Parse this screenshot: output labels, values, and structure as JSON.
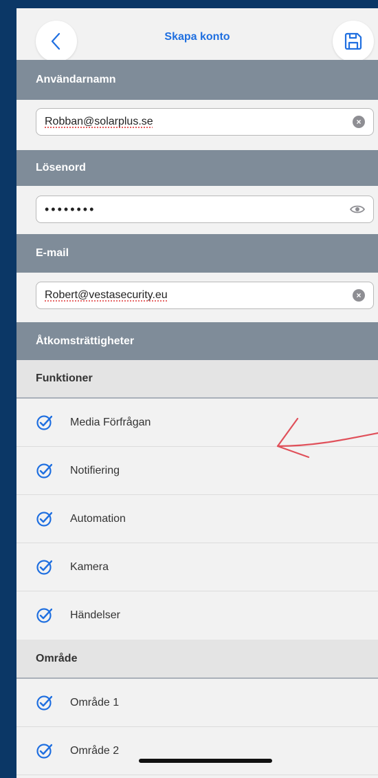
{
  "header": {
    "title": "Skapa konto",
    "back_icon": "chevron-left-icon",
    "save_icon": "floppy-disk-icon",
    "accent": "#1f6fe0"
  },
  "username": {
    "label": "Användarnamn",
    "value": "Robban@solarplus.se"
  },
  "password": {
    "label": "Lösenord",
    "value": "••••••••"
  },
  "email": {
    "label": "E-mail",
    "value": "Robert@vestasecurity.eu"
  },
  "access": {
    "label": "Åtkomsträttigheter",
    "functions": {
      "label": "Funktioner",
      "items": [
        {
          "label": "Media Förfrågan",
          "checked": true
        },
        {
          "label": "Notifiering",
          "checked": true
        },
        {
          "label": "Automation",
          "checked": true
        },
        {
          "label": "Kamera",
          "checked": true
        },
        {
          "label": "Händelser",
          "checked": true
        }
      ]
    },
    "areas": {
      "label": "Område",
      "items": [
        {
          "label": "Område 1",
          "checked": true
        },
        {
          "label": "Område 2",
          "checked": true
        }
      ]
    }
  },
  "colors": {
    "page_bg": "#0b3766",
    "section_header": "#7f8c99",
    "check": "#1f6fe0",
    "annotation_arrow": "#e0505a"
  }
}
